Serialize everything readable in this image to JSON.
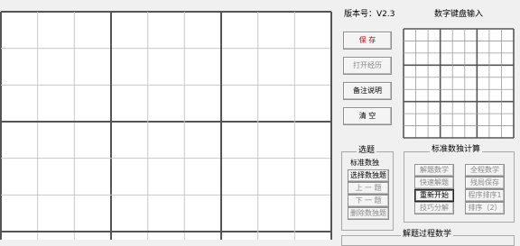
{
  "version_label": "版本号：V2.3",
  "keypad_title": "数字键盘输入",
  "buttons": {
    "save": "保 存",
    "open_puzzle": "打开经历",
    "notes": "备注说明",
    "clear": "清 空"
  },
  "select_group": {
    "title": "选题",
    "standard": "标准数独",
    "choose_puzzle": "选择数独题",
    "prev": "上 一 题",
    "next": "下 一 题",
    "delete_puzzle": "删除数独题"
  },
  "calc_group": {
    "title": "标准数独计算",
    "left": [
      "解题数学",
      "快速解题",
      "重新开始",
      "技巧分解"
    ],
    "right": [
      "全程数学",
      "残局保存",
      "程序排序1",
      "排序（2）"
    ]
  },
  "bottom_group": {
    "title": "解题过程数学"
  },
  "colors": {
    "background": "#f0f0f0",
    "grid_thick": "#555555",
    "grid_thin": "#c8c8c8",
    "accent_red": "#cc0000",
    "disabled_gray": "#8a8a8a"
  }
}
